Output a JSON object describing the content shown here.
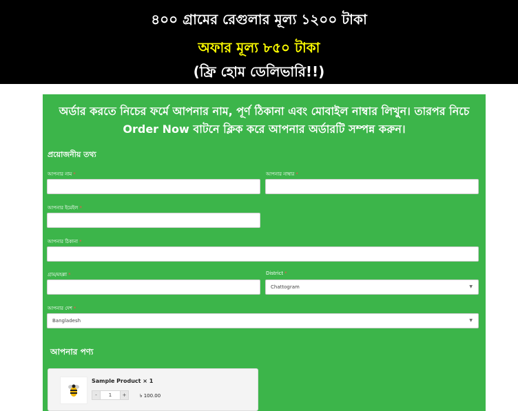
{
  "banner": {
    "line1": "৪০০ গ্রামের রেগুলার মূল্য ১২০০ টাকা",
    "line2": "অফার মূল্য ৮৫০ টাকা",
    "line3": "(ফ্রি হোম ডেলিভারি!!)"
  },
  "form": {
    "intro": "অর্ডার করতে নিচের ফর্মে আপনার নাম, পূর্ণ ঠিকানা এবং মোবাইল নাম্বার লিখুন। তারপর নিচে Order Now বাটনে ক্লিক করে আপনার অর্ডারটি সম্পন্ন করুন।",
    "section_title": "প্রয়োজনীয় তথ্য",
    "required_mark": "*",
    "name_label": "আপনার নাম",
    "phone_label": "আপনার নাম্বার",
    "email_label": "আপনার ইমেইল",
    "address_label": "আপনার ঠিকানা",
    "village_label": "গ্রাম/মহল্লা",
    "district_label": "District",
    "district_value": "Chattogram",
    "country_label": "আপনার দেশ",
    "country_value": "Bangladesh"
  },
  "products": {
    "title": "আপনার পণ্য",
    "item_name": "Sample Product × 1",
    "qty_minus": "-",
    "qty_value": "1",
    "qty_plus": "+",
    "price": "৳ 100.00"
  },
  "icons": {
    "product_thumb": "bee-logo-icon",
    "select_caret": "chevron-down-icon"
  },
  "colors": {
    "banner_bg": "#000000",
    "banner_accent": "#ffff00",
    "panel_bg": "#3cb54a",
    "required": "#ff4d4d"
  }
}
